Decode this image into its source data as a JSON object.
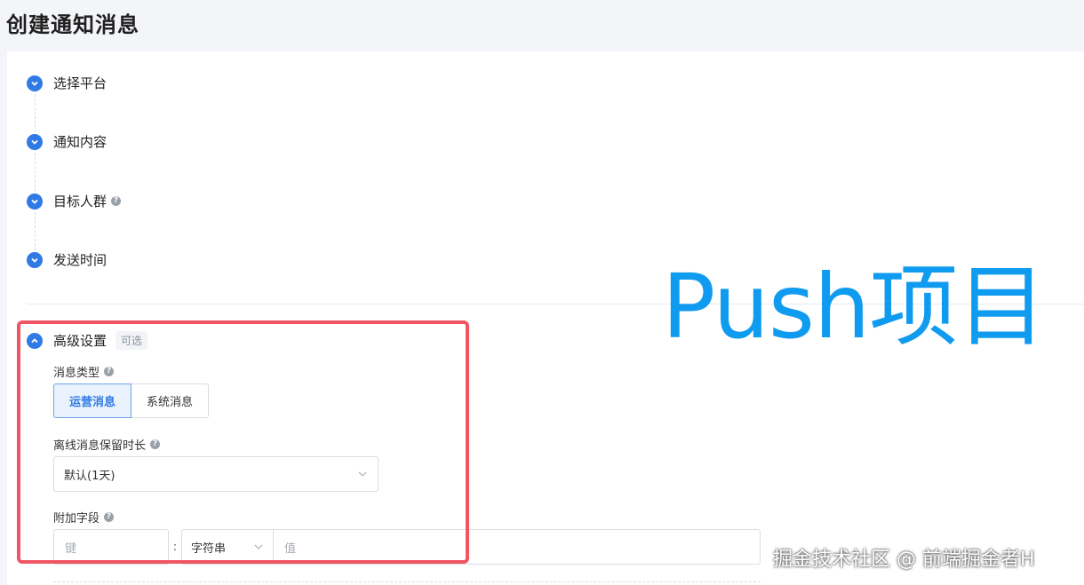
{
  "page": {
    "title": "创建通知消息"
  },
  "steps": [
    {
      "label": "选择平台",
      "help": false
    },
    {
      "label": "通知内容",
      "help": false
    },
    {
      "label": "目标人群",
      "help": true
    },
    {
      "label": "发送时间",
      "help": false
    }
  ],
  "advanced": {
    "title": "高级设置",
    "badge": "可选",
    "message_type": {
      "label": "消息类型",
      "options": [
        "运营消息",
        "系统消息"
      ],
      "selected": "运营消息"
    },
    "offline_retention": {
      "label": "离线消息保留时长",
      "value": "默认(1天)"
    },
    "extra_fields": {
      "label": "附加字段",
      "key_placeholder": "键",
      "separator": ":",
      "type_value": "字符串",
      "value_placeholder": "值"
    }
  },
  "overlay": {
    "text": "Push项目"
  },
  "watermark": {
    "text": "掘金技术社区 @ 前端掘金者H"
  },
  "colors": {
    "accent": "#2f7ae5",
    "highlight_border": "#ef5563",
    "overlay_text": "#0f9bef"
  },
  "icons": {
    "step": "check-chevron-icon",
    "advanced": "chevron-up-icon",
    "help": "question-icon",
    "select": "chevron-down-icon"
  }
}
